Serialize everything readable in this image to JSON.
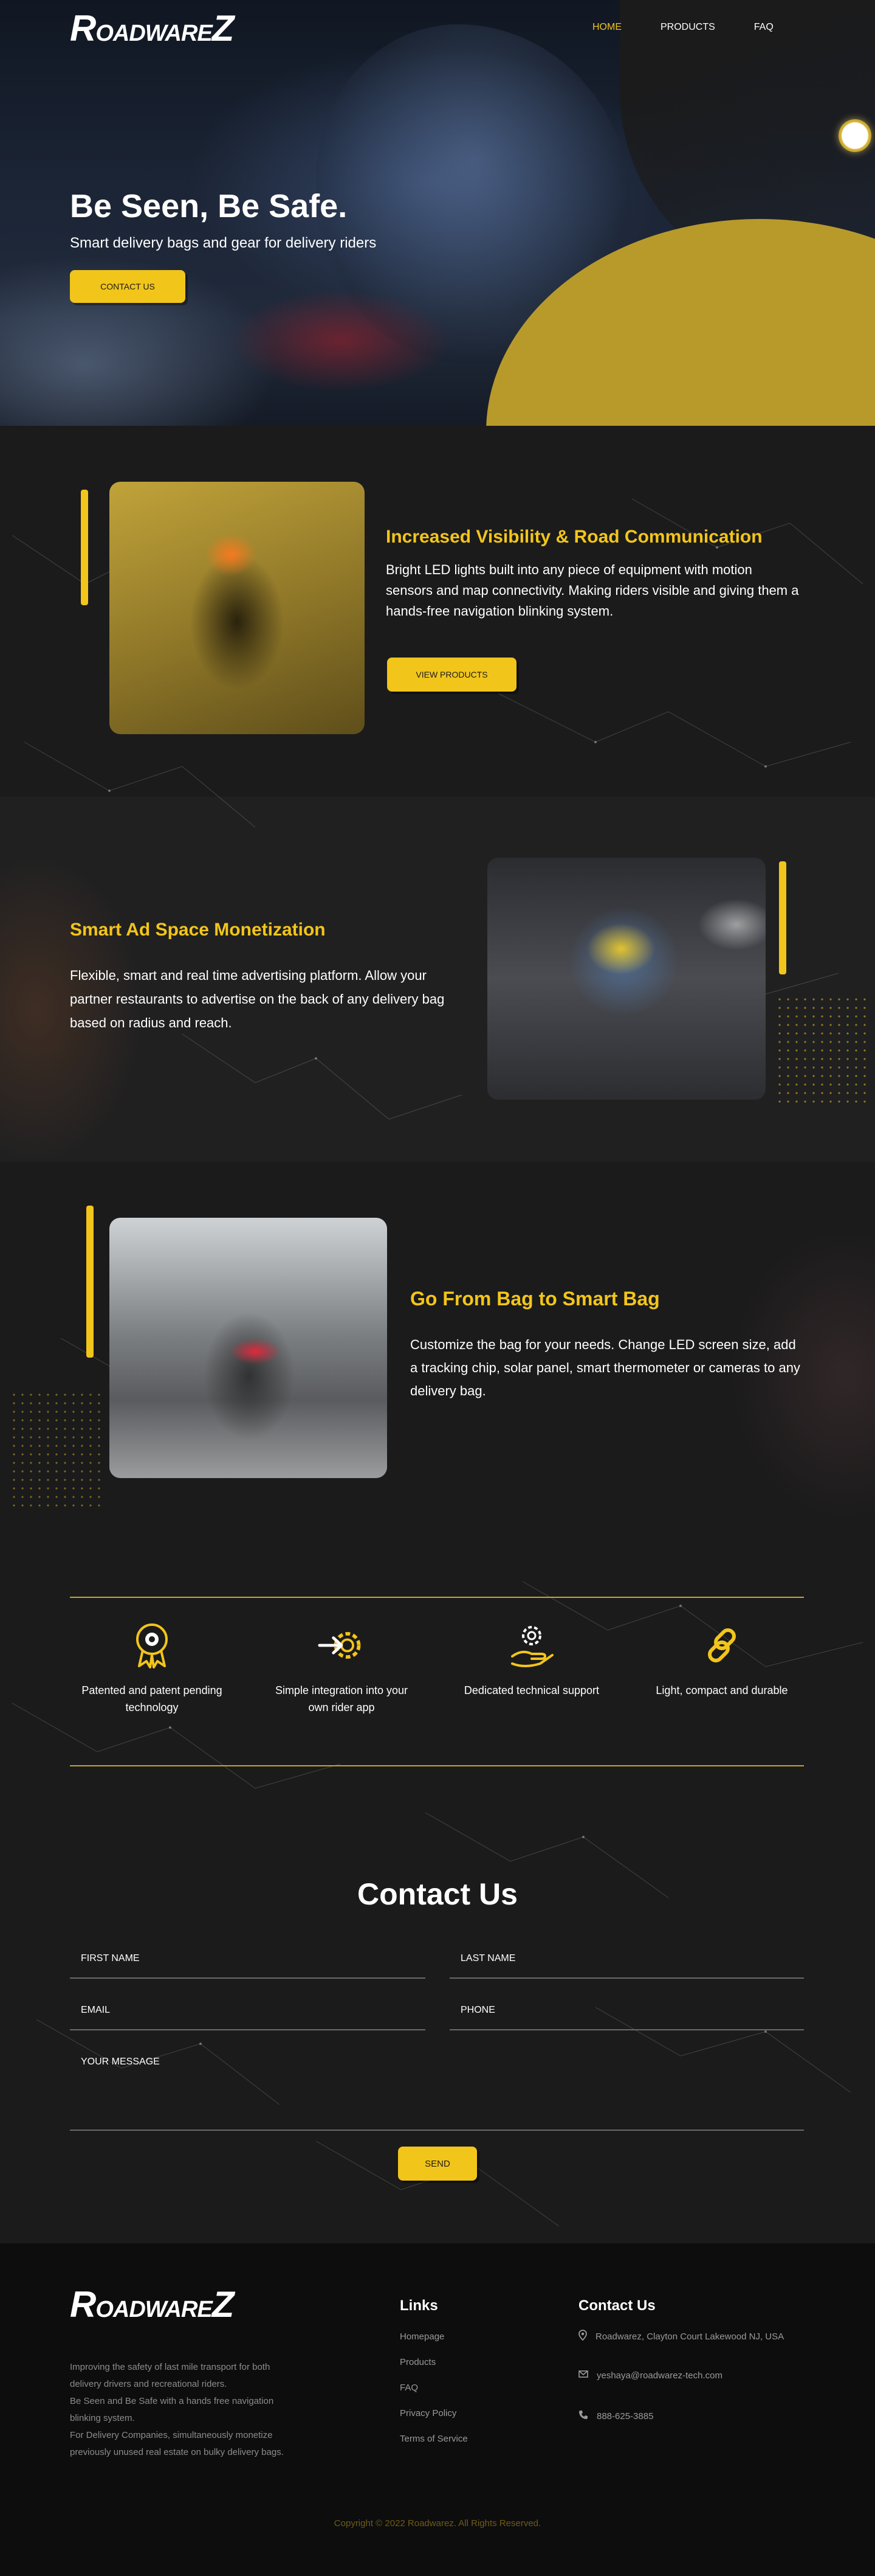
{
  "header": {
    "logo": "RoadwareZ",
    "nav": [
      {
        "label": "HOME",
        "active": true
      },
      {
        "label": "PRODUCTS",
        "active": false
      },
      {
        "label": "FAQ",
        "active": false
      }
    ]
  },
  "hero": {
    "title": "Be Seen,  Be Safe.",
    "subtitle": "Smart delivery bags and gear for delivery riders",
    "cta": "CONTACT US"
  },
  "features": [
    {
      "title": "Increased Visibility & Road Communication",
      "text": "Bright LED lights built into any piece of equipment with motion sensors and map connectivity. Making riders visible and giving them a hands-free navigation blinking system.",
      "button": "VIEW PRODUCTS"
    },
    {
      "title": "Smart Ad Space Monetization",
      "text": "Flexible, smart and real time advertising platform. Allow your partner restaurants to advertise on the back of any delivery bag based on radius and reach."
    },
    {
      "title": "Go From Bag to Smart Bag",
      "text": "Customize the bag for your needs. Change LED screen size, add a tracking chip, solar panel, smart thermometer or cameras to any delivery bag."
    }
  ],
  "benefits": [
    {
      "icon": "award-badge-icon",
      "label": "Patented and patent pending technology"
    },
    {
      "icon": "integration-arrow-gear-icon",
      "label": "Simple integration into your own rider app"
    },
    {
      "icon": "support-hand-gear-icon",
      "label": "Dedicated technical support"
    },
    {
      "icon": "link-chain-icon",
      "label": "Light, compact and durable"
    }
  ],
  "contact": {
    "title": "Contact Us",
    "fields": {
      "first_name": "FIRST NAME",
      "last_name": "LAST NAME",
      "email": "EMAIL",
      "phone": "PHONE",
      "message": "YOUR MESSAGE"
    },
    "send": "SEND"
  },
  "footer": {
    "logo": "RoadwareZ",
    "about": [
      "Improving the safety of last mile transport for both delivery drivers and recreational riders.",
      "Be Seen and Be Safe with a hands free navigation blinking system.",
      "For Delivery Companies, simultaneously monetize previously unused real estate on bulky delivery bags."
    ],
    "links_heading": "Links",
    "links": [
      "Homepage",
      "Products",
      "FAQ",
      "Privacy Policy",
      "Terms of Service"
    ],
    "contact_heading": "Contact Us",
    "address": "Roadwarez, Clayton Court Lakewood NJ, USA",
    "email": "yeshaya@roadwarez-tech.com",
    "phone": "888-625-3885",
    "copyright": "Copyright © 2022 Roadwarez. All Rights Reserved."
  },
  "colors": {
    "accent": "#f2c51a",
    "background": "#1b1b1c",
    "footer": "#0d0d0d"
  }
}
